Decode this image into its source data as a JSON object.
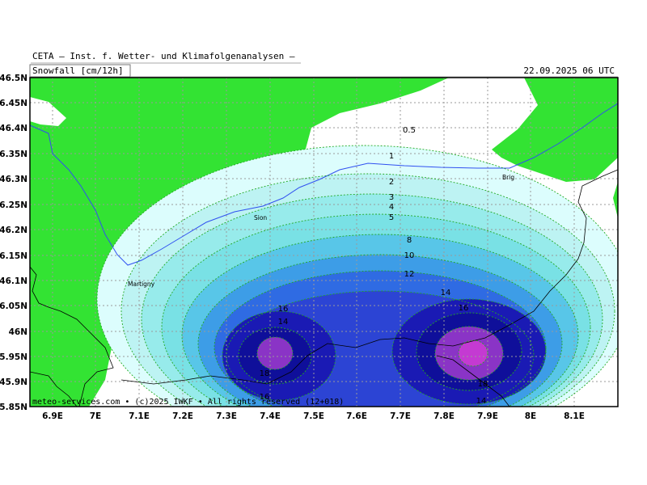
{
  "header": {
    "institute": "CETA — Inst. f. Wetter- und Klimafolgenanalysen —",
    "variable": "Snowfall [cm/12h]",
    "datetime": "22.09.2025 06 UTC"
  },
  "footer": "meteo-services.com • (c)2025 IWKF • All rights reserved (12+018)",
  "axes": {
    "x_ticks": [
      "6.9E",
      "7E",
      "7.1E",
      "7.2E",
      "7.3E",
      "7.4E",
      "7.5E",
      "7.6E",
      "7.7E",
      "7.8E",
      "7.9E",
      "8E",
      "8.1E"
    ],
    "y_ticks": [
      "46.5N",
      "46.45N",
      "46.4N",
      "46.35N",
      "46.3N",
      "46.25N",
      "46.2N",
      "46.15N",
      "46.1N",
      "46.05N",
      "46N",
      "45.95N",
      "45.9N",
      "45.85N"
    ]
  },
  "cities": [
    {
      "name": "Sion"
    },
    {
      "name": "Martigny"
    },
    {
      "name": "Brig"
    }
  ],
  "contour_labels": [
    "0.5",
    "1",
    "2",
    "3",
    "4",
    "5",
    "8",
    "10",
    "12",
    "14",
    "16",
    "14",
    "16",
    "18",
    "18",
    "14",
    "16",
    "14"
  ],
  "colors": {
    "land_green": "#33e333",
    "snow_levels": [
      "#dcfdfd",
      "#bdf3f3",
      "#97ebeb",
      "#79e1e5",
      "#58c6e8",
      "#3d9de7",
      "#2f6be3",
      "#2c44d4",
      "#1a1ab4",
      "#0f0f9a",
      "#8a34c6",
      "#c43ad2"
    ],
    "river": "#3050f0",
    "grid": "#9a9a9a"
  }
}
